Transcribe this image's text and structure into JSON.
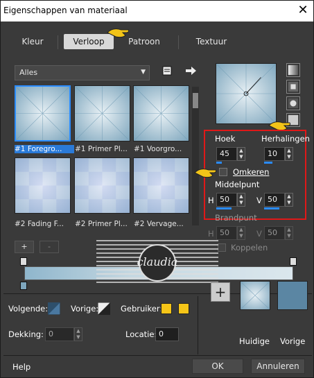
{
  "window": {
    "title": "Eigenschappen van materiaal",
    "close_label": "✕"
  },
  "tabs": [
    {
      "label": "Kleur",
      "active": false
    },
    {
      "label": "Verloop",
      "active": true
    },
    {
      "label": "Patroon",
      "active": false
    },
    {
      "label": "Textuur",
      "active": false
    }
  ],
  "library": {
    "dropdown_value": "Alles",
    "thumbnails": [
      {
        "label": "#1 Foregro...",
        "selected": true
      },
      {
        "label": "#1 Primer Pl...",
        "selected": false
      },
      {
        "label": "#1 Voorgro...",
        "selected": false
      },
      {
        "label": "#2 Fading F...",
        "selected": false
      },
      {
        "label": "#2 Primer Pl...",
        "selected": false
      },
      {
        "label": "#2 Vervage...",
        "selected": false
      }
    ]
  },
  "settings": {
    "hoek_label": "Hoek",
    "hoek_value": "45",
    "herhalingen_label": "Herhalingen",
    "herhalingen_value": "10",
    "omkeren_label": "Omkeren",
    "middelpunt_label": "Middelpunt",
    "h_label": "H",
    "h_value": "50",
    "v_label": "V",
    "v_value": "50",
    "brandpunt_label": "Brandpunt",
    "bp_h_value": "50",
    "bp_v_value": "50",
    "koppelen_label": "Koppelen"
  },
  "editor": {
    "add_label": "+",
    "remove_label": "-",
    "watermark_text": "claudia"
  },
  "stops": {
    "volgende_label": "Volgende:",
    "vorige_label": "Vorige:",
    "gebruiker_label": "Gebruiker:",
    "user_color_1": "#f5c518",
    "user_color_2": "#f5c518",
    "dekking_label": "Dekking:",
    "dekking_value": "0",
    "locatie_label": "Locatie:",
    "locatie_value": "0"
  },
  "swatches": {
    "plus_label": "+",
    "huidige_label": "Huidige",
    "vorige_label": "Vorige",
    "vorige_color": "#5b86a3"
  },
  "footer": {
    "help_label": "Help",
    "ok_label": "OK",
    "cancel_label": "Annuleren"
  }
}
